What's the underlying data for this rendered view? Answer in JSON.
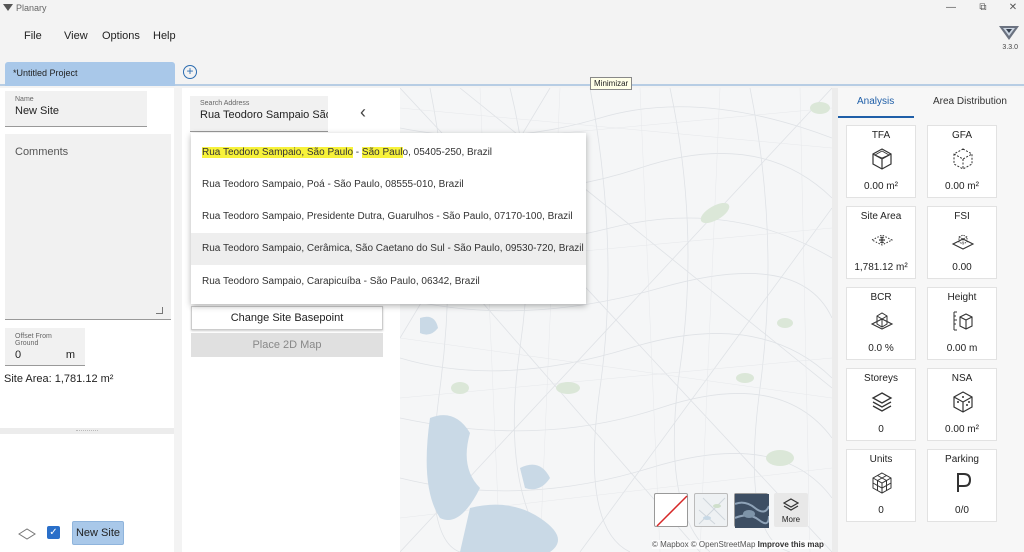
{
  "window": {
    "title": "Planary",
    "minimize": "—",
    "restore": "⧉",
    "close": "✕"
  },
  "menu": {
    "items": [
      "File",
      "View",
      "Options",
      "Help"
    ],
    "version": "3.3.0"
  },
  "tabs": {
    "project": "*Untitled Project",
    "add": "+"
  },
  "tooltip": "Minimizar",
  "site": {
    "name_label": "Name",
    "name_value": "New Site",
    "comments_placeholder": "Comments",
    "offset_label": "Offset From Ground",
    "offset_value": "0",
    "offset_unit": "m",
    "site_area": "Site Area: 1,781.12 m²",
    "new_site_button": "New Site"
  },
  "search": {
    "label": "Search Address",
    "value": "Rua Teodoro Sampaio São",
    "back": "‹",
    "results": [
      {
        "pre": "",
        "h1": "Rua Teodoro Sampaio, São Paulo",
        "mid": " - ",
        "h2": "São Paul",
        "post": "o, 05405-250, Brazil"
      },
      {
        "pre": "Rua Teodoro Sampaio, Poá - São Paulo, 08555-010, Brazil",
        "h1": "",
        "mid": "",
        "h2": "",
        "post": ""
      },
      {
        "pre": "Rua Teodoro Sampaio, Presidente Dutra, Guarulhos - São Paulo, 07170-100, Brazil",
        "h1": "",
        "mid": "",
        "h2": "",
        "post": ""
      },
      {
        "pre": "Rua Teodoro Sampaio, Cerâmica, São Caetano do Sul - São Paulo, 09530-720, Brazil",
        "h1": "",
        "mid": "",
        "h2": "",
        "post": ""
      },
      {
        "pre": "Rua Teodoro Sampaio, Carapicuíba - São Paulo, 06342, Brazil",
        "h1": "",
        "mid": "",
        "h2": "",
        "post": ""
      }
    ],
    "change_basepoint": "Change Site Basepoint",
    "place_map": "Place 2D Map"
  },
  "map": {
    "more": "More",
    "attribution": "© Mapbox © OpenStreetMap",
    "improve": "Improve this map"
  },
  "analysis": {
    "tab_analysis": "Analysis",
    "tab_distribution": "Area Distribution",
    "cards": [
      {
        "title": "TFA",
        "value": "0.00 m²",
        "icon": "cube-solid-icon"
      },
      {
        "title": "GFA",
        "value": "0.00 m²",
        "icon": "cube-dashed-icon"
      },
      {
        "title": "Site Area",
        "value": "1,781.12 m²",
        "icon": "site-area-icon"
      },
      {
        "title": "FSI",
        "value": "0.00",
        "icon": "fsi-icon"
      },
      {
        "title": "BCR",
        "value": "0.0 %",
        "icon": "bcr-icon"
      },
      {
        "title": "Height",
        "value": "0.00 m",
        "icon": "height-icon"
      },
      {
        "title": "Storeys",
        "value": "0",
        "icon": "layers-icon"
      },
      {
        "title": "NSA",
        "value": "0.00 m²",
        "icon": "dice-icon"
      },
      {
        "title": "Units",
        "value": "0",
        "icon": "units-icon"
      },
      {
        "title": "Parking",
        "value": "0/0",
        "icon": "parking-icon"
      }
    ]
  }
}
